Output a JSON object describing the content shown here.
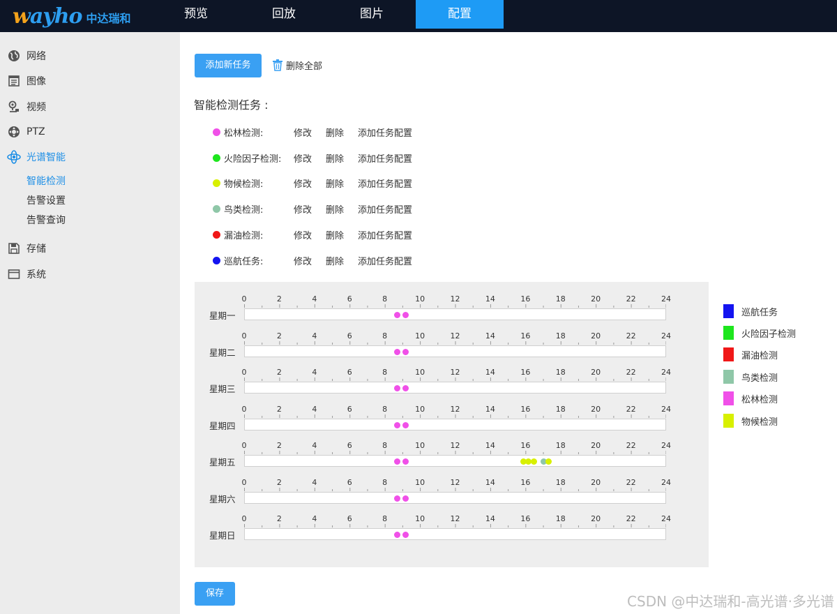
{
  "brand": {
    "logo_text": "wayho",
    "company": "中达瑞和"
  },
  "nav": [
    {
      "label": "预览",
      "active": false
    },
    {
      "label": "回放",
      "active": false
    },
    {
      "label": "图片",
      "active": false
    },
    {
      "label": "配置",
      "active": true
    }
  ],
  "sidebar": {
    "items": [
      {
        "label": "网络",
        "icon": "globe-icon"
      },
      {
        "label": "图像",
        "icon": "image-doc-icon"
      },
      {
        "label": "视频",
        "icon": "camera-icon"
      },
      {
        "label": "PTZ",
        "icon": "ptz-icon"
      },
      {
        "label": "光谱智能",
        "icon": "spectrum-icon",
        "active": true
      },
      {
        "label": "存储",
        "icon": "save-icon"
      },
      {
        "label": "系统",
        "icon": "window-icon"
      }
    ],
    "subitems": [
      {
        "label": "智能检测",
        "active": true
      },
      {
        "label": "告警设置",
        "active": false
      },
      {
        "label": "告警查询",
        "active": false
      }
    ]
  },
  "toolbar": {
    "add_task_label": "添加新任务",
    "delete_all_label": "删除全部"
  },
  "section_title": "智能检测任务 :",
  "tasks": [
    {
      "name": "松林检测:",
      "color": "#f050e8"
    },
    {
      "name": "火险因子检测:",
      "color": "#1ee61e"
    },
    {
      "name": "物候检测:",
      "color": "#d8f000"
    },
    {
      "name": "鸟类检测:",
      "color": "#8fc7a8"
    },
    {
      "name": "漏油检测:",
      "color": "#f01818"
    },
    {
      "name": "巡航任务:",
      "color": "#1414f0"
    }
  ],
  "task_actions": {
    "edit": "修改",
    "delete": "删除",
    "add_config": "添加任务配置"
  },
  "schedule": {
    "hour_labels": [
      "0",
      "2",
      "4",
      "6",
      "8",
      "10",
      "12",
      "14",
      "16",
      "18",
      "20",
      "22",
      "24"
    ],
    "days": [
      {
        "label": "星期一",
        "events": [
          {
            "hour": 8.7,
            "color": "#f050e8"
          },
          {
            "hour": 9.2,
            "color": "#f050e8"
          }
        ]
      },
      {
        "label": "星期二",
        "events": [
          {
            "hour": 8.7,
            "color": "#f050e8"
          },
          {
            "hour": 9.2,
            "color": "#f050e8"
          }
        ]
      },
      {
        "label": "星期三",
        "events": [
          {
            "hour": 8.7,
            "color": "#f050e8"
          },
          {
            "hour": 9.2,
            "color": "#f050e8"
          }
        ]
      },
      {
        "label": "星期四",
        "events": [
          {
            "hour": 8.7,
            "color": "#f050e8"
          },
          {
            "hour": 9.2,
            "color": "#f050e8"
          }
        ]
      },
      {
        "label": "星期五",
        "events": [
          {
            "hour": 8.7,
            "color": "#f050e8"
          },
          {
            "hour": 9.2,
            "color": "#f050e8"
          },
          {
            "hour": 15.9,
            "color": "#d8f000"
          },
          {
            "hour": 16.15,
            "color": "#d8f000"
          },
          {
            "hour": 16.5,
            "color": "#d8f000"
          },
          {
            "hour": 17.05,
            "color": "#8fc7a8"
          },
          {
            "hour": 17.3,
            "color": "#d8f000"
          }
        ]
      },
      {
        "label": "星期六",
        "events": [
          {
            "hour": 8.7,
            "color": "#f050e8"
          },
          {
            "hour": 9.2,
            "color": "#f050e8"
          }
        ]
      },
      {
        "label": "星期日",
        "events": [
          {
            "hour": 8.7,
            "color": "#f050e8"
          },
          {
            "hour": 9.2,
            "color": "#f050e8"
          }
        ]
      }
    ]
  },
  "legend": [
    {
      "label": "巡航任务",
      "color": "#1414f0"
    },
    {
      "label": "火险因子检测",
      "color": "#1ee61e"
    },
    {
      "label": "漏油检测",
      "color": "#f01818"
    },
    {
      "label": "鸟类检测",
      "color": "#8fc7a8"
    },
    {
      "label": "松林检测",
      "color": "#f050e8"
    },
    {
      "label": "物候检测",
      "color": "#d8f000"
    }
  ],
  "save_label": "保存",
  "watermark": "CSDN @中达瑞和-高光谱·多光谱"
}
